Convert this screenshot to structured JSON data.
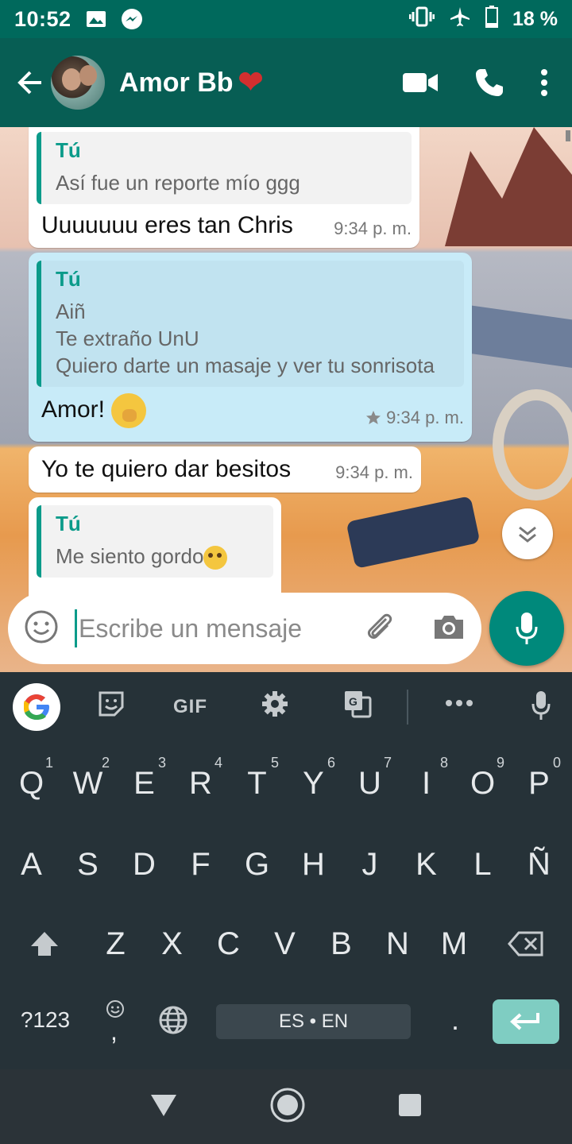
{
  "status_bar": {
    "time": "10:52",
    "battery": "18 %"
  },
  "header": {
    "contact_name": "Amor Bb",
    "heart": "❤"
  },
  "messages": [
    {
      "quote_author": "Tú",
      "quote_lines": [
        "Así fue un reporte mío ggg"
      ],
      "text": "Uuuuuuu eres tan Chris",
      "time": "9:34 p. m."
    },
    {
      "quote_author": "Tú",
      "quote_lines": [
        "Aiñ",
        "Te extraño UnU",
        "Quiero darte un masaje y ver tu sonrisota"
      ],
      "text": "Amor!",
      "time": "9:34 p. m.",
      "starred": true
    },
    {
      "text": "Yo te quiero dar besitos",
      "time": "9:34 p. m."
    },
    {
      "quote_author": "Tú",
      "quote_lines": [
        "Me siento gordo"
      ]
    }
  ],
  "input": {
    "placeholder": "Escribe un mensaje"
  },
  "keyboard": {
    "toolbar": {
      "gif": "GIF"
    },
    "row1": [
      [
        "Q",
        "1"
      ],
      [
        "W",
        "2"
      ],
      [
        "E",
        "3"
      ],
      [
        "R",
        "4"
      ],
      [
        "T",
        "5"
      ],
      [
        "Y",
        "6"
      ],
      [
        "U",
        "7"
      ],
      [
        "I",
        "8"
      ],
      [
        "O",
        "9"
      ],
      [
        "P",
        "0"
      ]
    ],
    "row2": [
      "A",
      "S",
      "D",
      "F",
      "G",
      "H",
      "J",
      "K",
      "L",
      "Ñ"
    ],
    "row3": [
      "Z",
      "X",
      "C",
      "V",
      "B",
      "N",
      "M"
    ],
    "symbols": "?123",
    "comma": ",",
    "space": "ES • EN",
    "period": "."
  },
  "colors": {
    "header": "#075e54",
    "accent": "#0b9b8a",
    "outgoing_bubble": "#c8ebf8",
    "keyboard": "#263238"
  }
}
